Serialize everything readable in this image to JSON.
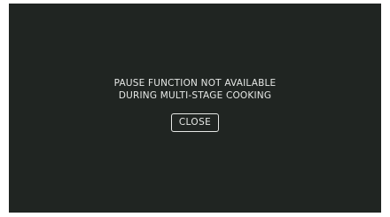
{
  "dialog": {
    "message_line1": "PAUSE FUNCTION NOT AVAILABLE",
    "message_line2": "DURING MULTI-STAGE COOKING",
    "close_label": "CLOSE"
  },
  "colors": {
    "background": "#202522",
    "text": "#e6e8e6",
    "border": "#e6e8e6"
  }
}
